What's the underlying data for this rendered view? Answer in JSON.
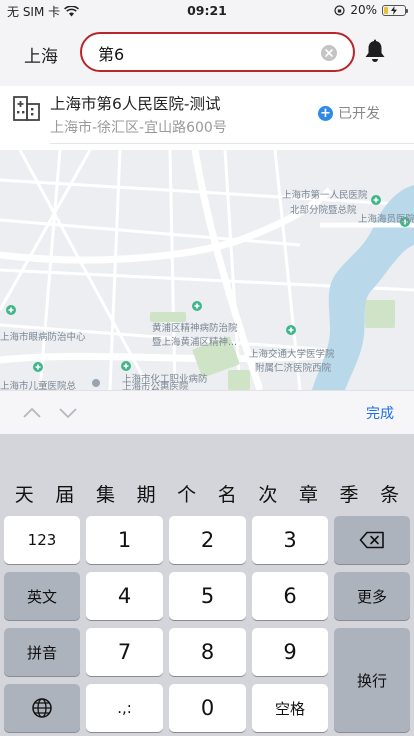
{
  "status_bar": {
    "carrier": "无 SIM 卡",
    "time": "09:21",
    "battery_text": "20%",
    "battery_level": 0.2
  },
  "header": {
    "city": "上海",
    "search_value": "第6",
    "icons": [
      "close-icon",
      "bell-icon"
    ]
  },
  "result": {
    "title": "上海市第6人民医院-测试",
    "address": "上海市-徐汇区-宜山路600号",
    "status": "已开发"
  },
  "map": {
    "labels": [
      "上海市第一人民医院",
      "北部分院暨总院",
      "上海海员医院",
      "上海市眼病防治中心",
      "黄浦区精神病防治院",
      "暨上海黄浦区精神...",
      "上海交通大学医学院",
      "附属仁济医院西院",
      "上海市化工职业病防",
      "上海市儿童医院总",
      "上海市公惠医院"
    ]
  },
  "toolbar": {
    "done_label": "完成"
  },
  "keyboard": {
    "candidates": [
      "天",
      "届",
      "集",
      "期",
      "个",
      "名",
      "次",
      "章",
      "季",
      "条"
    ],
    "keys": {
      "k123": "123",
      "k1": "1",
      "k2": "2",
      "k3": "3",
      "k4": "4",
      "k5": "5",
      "k6": "6",
      "k7": "7",
      "k8": "8",
      "k9": "9",
      "k0": "0",
      "english": "英文",
      "more": "更多",
      "pinyin": "拼音",
      "newline": "换行",
      "punct": ".,:",
      "space": "空格"
    }
  }
}
